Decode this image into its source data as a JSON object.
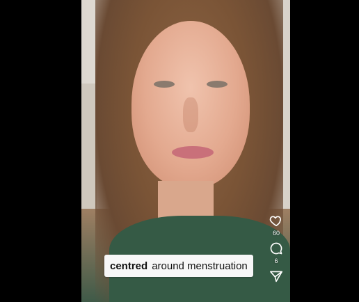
{
  "caption": {
    "bold": "centred",
    "rest": "around menstruation"
  },
  "actions": {
    "like": {
      "icon": "heart-icon",
      "count": "60"
    },
    "comment": {
      "icon": "comment-icon",
      "count": "6"
    },
    "share": {
      "icon": "send-icon"
    }
  }
}
